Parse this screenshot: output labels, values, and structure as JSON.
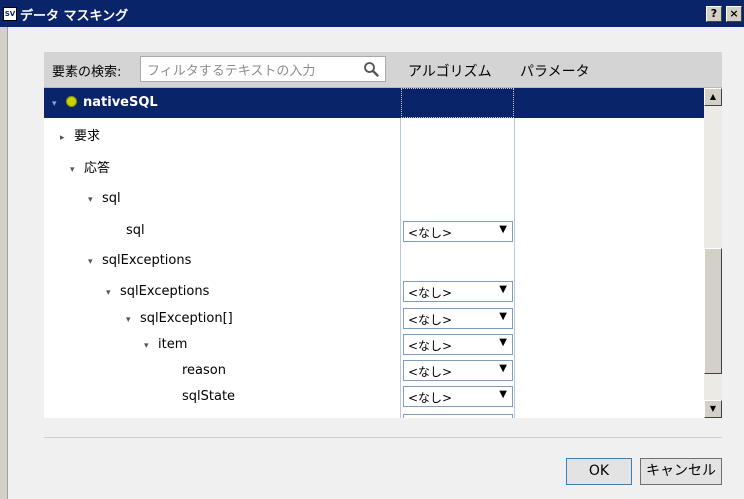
{
  "window": {
    "title": "データ マスキング",
    "app_icon": "SV",
    "help_button": "?",
    "close_button": "×"
  },
  "header": {
    "search_label": "要素の検索:",
    "search_placeholder": "フィルタするテキストの入力",
    "col_algorithm": "アルゴリズム",
    "col_parameter": "パラメータ"
  },
  "tree": {
    "root": "nativeSQL",
    "request": "要求",
    "response": "応答",
    "sql_group": "sql",
    "sql_leaf": "sql",
    "sqlexceptions_group": "sqlExceptions",
    "sqlexceptions_child": "sqlExceptions",
    "sqlexception_array": "sqlException[]",
    "item": "item",
    "reason": "reason",
    "sqlstate": "sqlState"
  },
  "combos": {
    "sql": "<なし>",
    "sqlexceptions": "<なし>",
    "sqlexception_array": "<なし>",
    "item": "<なし>",
    "reason": "<なし>",
    "sqlstate": "<なし>"
  },
  "icons": {
    "expanded": "▾",
    "collapsed": "▸",
    "dropdown": "▼",
    "scroll_up": "▲",
    "scroll_down": "▼"
  },
  "buttons": {
    "ok": "OK",
    "cancel": "キャンセル"
  },
  "colors": {
    "titlebar": "#0a246a",
    "selection": "#0a246a",
    "root_icon": "#c8d400"
  }
}
